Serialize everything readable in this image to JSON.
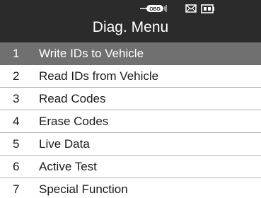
{
  "header": {
    "title": "Diag. Menu",
    "status_icons": {
      "obd": "obd-connection-icon",
      "mail": "mail-icon",
      "battery": "battery-icon",
      "obd_text": "OBD"
    },
    "colors": {
      "background": "#2b2b2b",
      "text": "#ffffff"
    }
  },
  "menu": {
    "selected_index": 0,
    "colors": {
      "selected_background": "#707070",
      "divider": "#b5b5b5"
    },
    "items": [
      {
        "number": "1",
        "label": "Write IDs to Vehicle"
      },
      {
        "number": "2",
        "label": "Read IDs from Vehicle"
      },
      {
        "number": "3",
        "label": "Read Codes"
      },
      {
        "number": "4",
        "label": "Erase Codes"
      },
      {
        "number": "5",
        "label": "Live Data"
      },
      {
        "number": "6",
        "label": "Active Test"
      },
      {
        "number": "7",
        "label": "Special Function"
      }
    ]
  }
}
